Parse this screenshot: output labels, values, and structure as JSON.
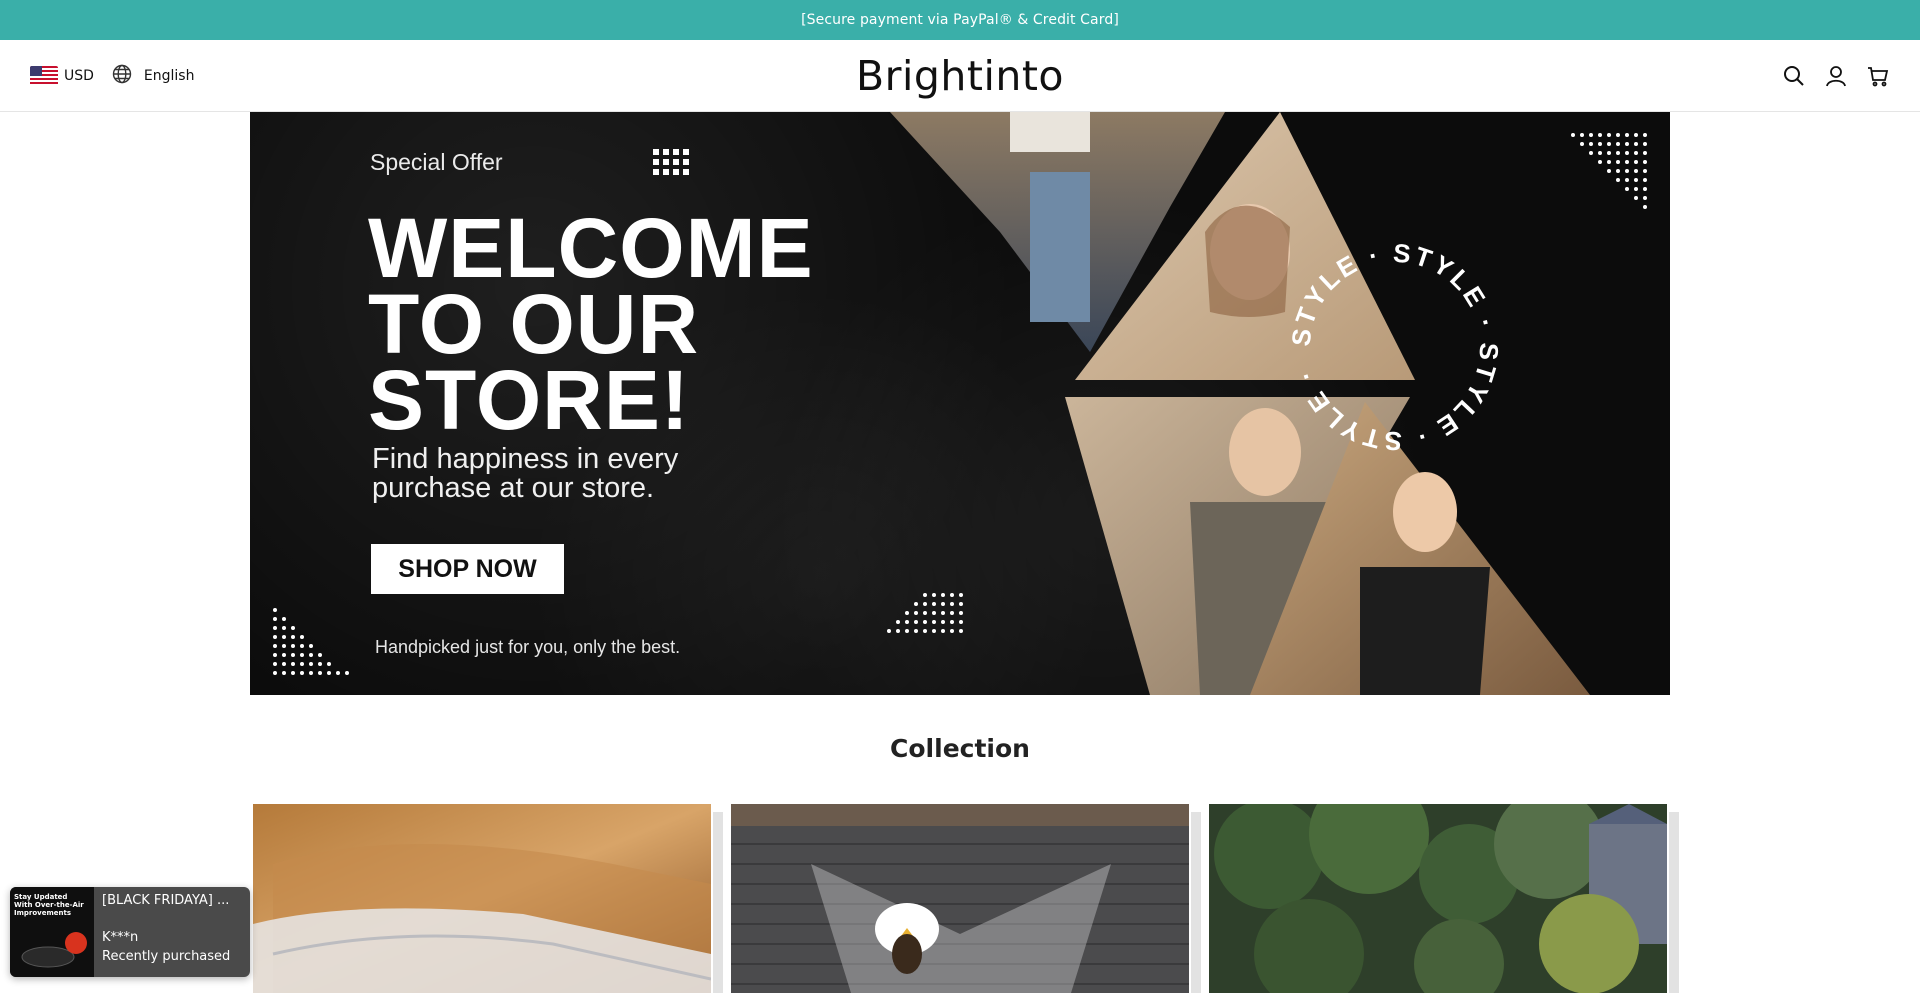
{
  "announcement": {
    "text": "[Secure payment via PayPal® & Credit Card]"
  },
  "header": {
    "currency": "USD",
    "language": "English",
    "logo": "Brightinto",
    "icons": [
      "search-icon",
      "account-icon",
      "cart-icon"
    ]
  },
  "banner": {
    "special": "Special Offer",
    "title_lines": [
      "WELCOME",
      "TO OUR",
      "STORE!"
    ],
    "subtitle": "Find happiness in every purchase at our store.",
    "cta": "SHOP NOW",
    "tagline": "Handpicked just for you, only the best.",
    "ring_text": "STYLE · STYLE · STYLE · STYLE ·"
  },
  "collection": {
    "title": "Collection"
  },
  "toast": {
    "title": "[BLACK FRIDAYA] ...",
    "name": "K***n",
    "status": "Recently purchased",
    "thumb_text": "Stay Updated With Over-the-Air Improvements"
  },
  "colors": {
    "announcement_bg": "#3aafa9",
    "banner_bg": "#0c0c0c",
    "toast_bg": "#4a4a4a"
  }
}
